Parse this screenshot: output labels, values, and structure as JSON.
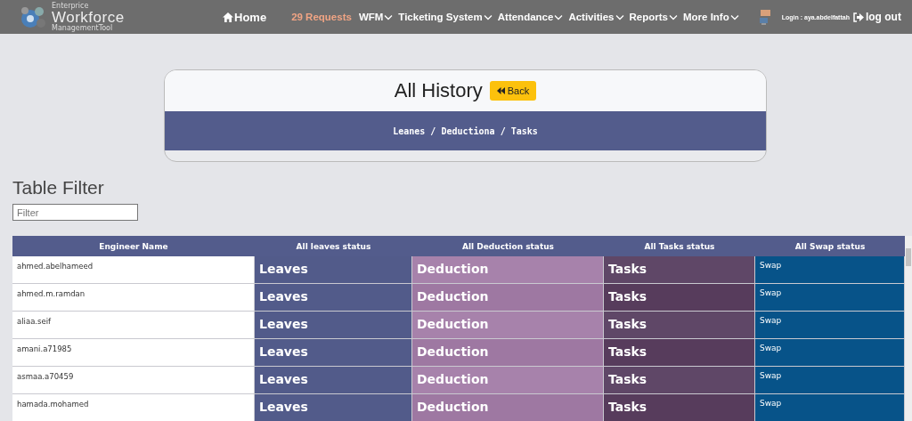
{
  "header": {
    "logo": {
      "small_top": "Enterprice",
      "big": "Workforce",
      "small_bottom": "ManagementTool"
    },
    "nav": [
      {
        "label": "Home",
        "kind": "home"
      },
      {
        "label": "29 Requests",
        "kind": "highlight"
      },
      {
        "label": "WFM",
        "kind": "dropdown"
      },
      {
        "label": "Ticketing System",
        "kind": "dropdown"
      },
      {
        "label": "Attendance",
        "kind": "dropdown"
      },
      {
        "label": "Activities",
        "kind": "dropdown"
      },
      {
        "label": "Reports",
        "kind": "dropdown"
      },
      {
        "label": "More Info",
        "kind": "dropdown"
      }
    ],
    "login": "Login : aya.abdelfattah",
    "logout": "log out"
  },
  "card": {
    "title": "All History",
    "back_button": "Back",
    "breadcrumb": "Leanes / Deductiona / Tasks"
  },
  "filter": {
    "heading": "Table Filter",
    "placeholder": "Filter"
  },
  "table": {
    "columns": [
      "Engineer Name",
      "All leaves status",
      "All Deduction status",
      "All Tasks status",
      "All Swap status"
    ],
    "rows": [
      {
        "name": "ahmed.abelhameed",
        "leaves": "Leaves",
        "deduction": "Deduction",
        "tasks": "Tasks",
        "swap": "Swap"
      },
      {
        "name": "ahmed.m.ramdan",
        "leaves": "Leaves",
        "deduction": "Deduction",
        "tasks": "Tasks",
        "swap": "Swap"
      },
      {
        "name": "aliaa.seif",
        "leaves": "Leaves",
        "deduction": "Deduction",
        "tasks": "Tasks",
        "swap": "Swap"
      },
      {
        "name": "amani.a71985",
        "leaves": "Leaves",
        "deduction": "Deduction",
        "tasks": "Tasks",
        "swap": "Swap"
      },
      {
        "name": "asmaa.a70459",
        "leaves": "Leaves",
        "deduction": "Deduction",
        "tasks": "Tasks",
        "swap": "Swap"
      },
      {
        "name": "hamada.mohamed",
        "leaves": "Leaves",
        "deduction": "Deduction",
        "tasks": "Tasks",
        "swap": "Swap"
      }
    ]
  }
}
